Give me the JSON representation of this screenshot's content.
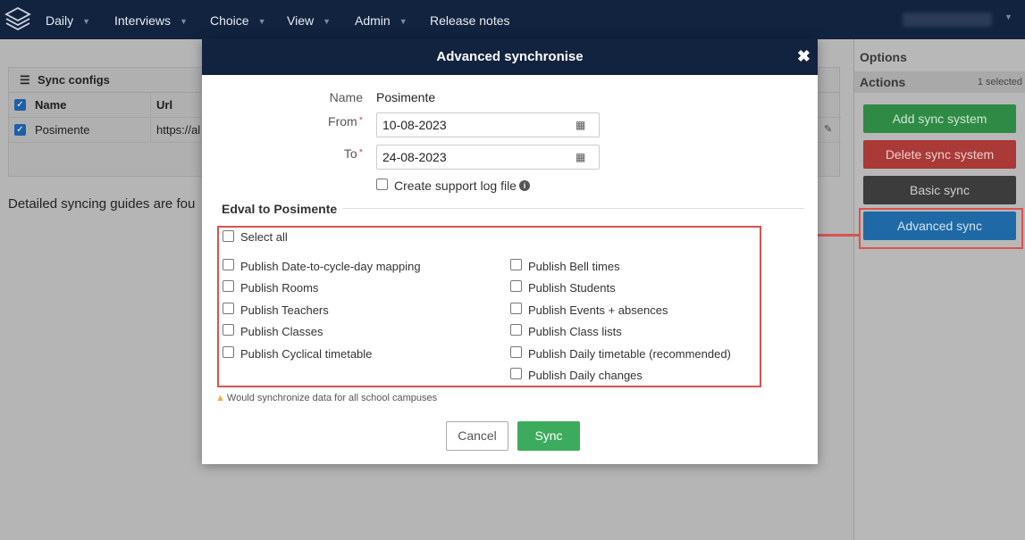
{
  "nav": {
    "items": [
      {
        "label": "Daily",
        "caret": true
      },
      {
        "label": "Interviews",
        "caret": true
      },
      {
        "label": "Choice",
        "caret": true
      },
      {
        "label": "View",
        "caret": true
      },
      {
        "label": "Admin",
        "caret": true
      },
      {
        "label": "Release notes",
        "caret": false
      }
    ]
  },
  "sync_configs": {
    "title": "Sync configs",
    "columns": [
      "Name",
      "Url"
    ],
    "rows": [
      {
        "name": "Posimente",
        "url": "https://al"
      }
    ]
  },
  "guides_text": "Detailed syncing guides are fou",
  "options_panel": {
    "title": "Options",
    "actions_label": "Actions",
    "selected_count": "1 selected",
    "buttons": {
      "add": "Add sync system",
      "delete": "Delete sync system",
      "basic": "Basic sync",
      "advanced": "Advanced sync"
    }
  },
  "modal": {
    "title": "Advanced synchronise",
    "close_icon": "close-icon",
    "name_label": "Name",
    "name_value": "Posimente",
    "from_label": "From",
    "from_value": "10-08-2023",
    "to_label": "To",
    "to_value": "24-08-2023",
    "required_mark": "*",
    "support_log_label": "Create support log file",
    "section_title": "Edval to Posimente",
    "select_all_label": "Select all",
    "left_options": [
      "Publish Date-to-cycle-day mapping",
      "Publish Rooms",
      "Publish Teachers",
      "Publish Classes",
      "Publish Cyclical timetable"
    ],
    "right_options": [
      "Publish Bell times",
      "Publish Students",
      "Publish Events + absences",
      "Publish Class lists",
      "Publish Daily timetable (recommended)",
      "Publish Daily changes"
    ],
    "warning": "Would synchronize data for all school campuses",
    "cancel_label": "Cancel",
    "sync_label": "Sync"
  },
  "colors": {
    "navbar": "#12233f",
    "highlight": "#d9534f",
    "sync_button": "#3dab5e"
  }
}
